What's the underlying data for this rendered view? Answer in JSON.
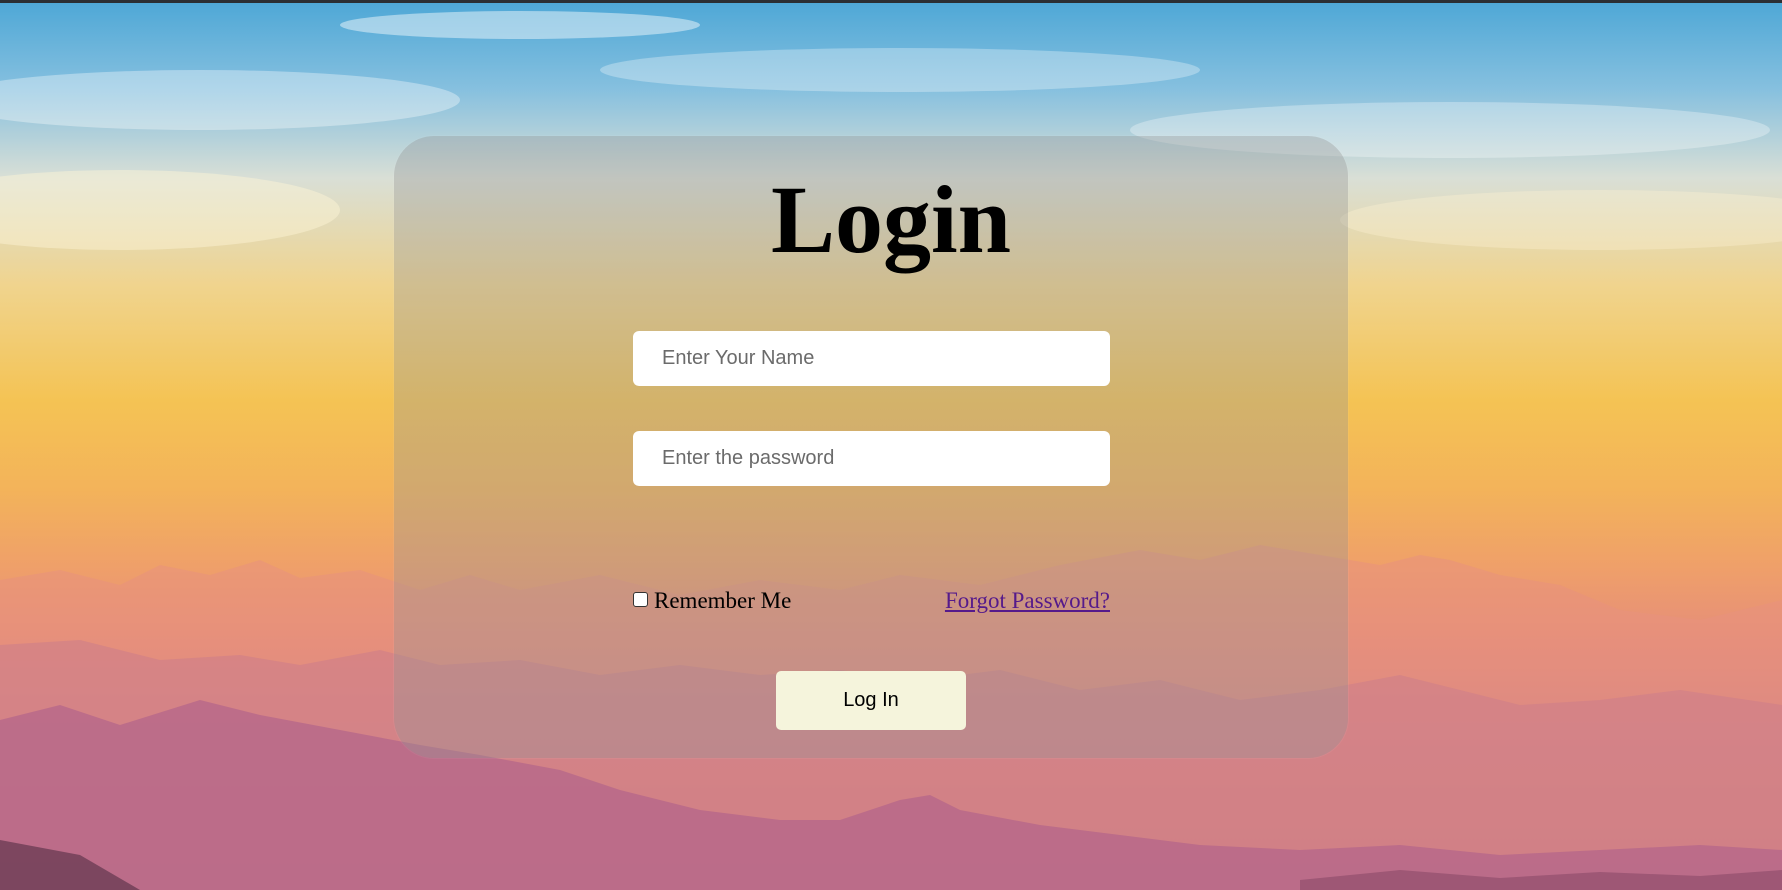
{
  "page": {
    "title": "Login"
  },
  "form": {
    "name_placeholder": "Enter Your Name",
    "name_value": "",
    "password_placeholder": "Enter the password",
    "password_value": "",
    "remember_label": "Remember Me",
    "remember_checked": false,
    "forgot_label": "Forgot Password?",
    "submit_label": "Log In"
  },
  "colors": {
    "card_bg": "rgba(150,150,150,0.35)",
    "button_bg": "#f5f4dc",
    "link": "#551a8b",
    "title": "#000000"
  }
}
